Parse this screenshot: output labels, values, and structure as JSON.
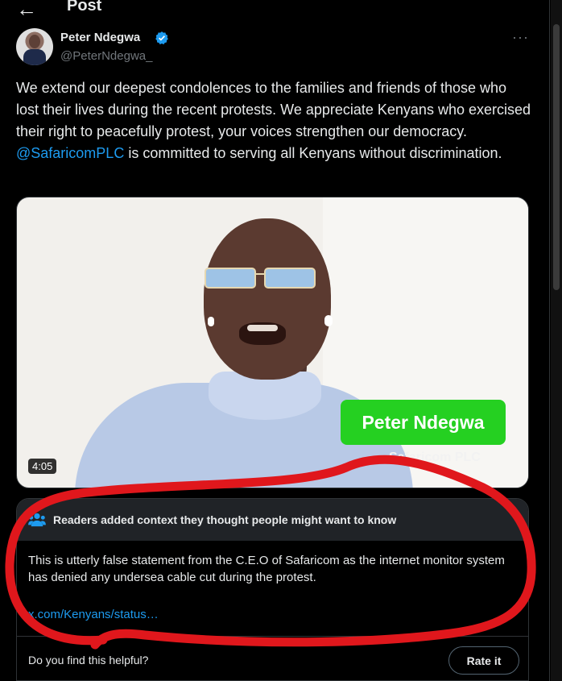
{
  "header": {
    "back_icon": "arrow-left-icon",
    "title": "Post"
  },
  "author": {
    "name": "Peter Ndegwa",
    "handle": "@PeterNdegwa_",
    "verified_icon": "verified-badge-icon",
    "verified_color": "#1d9bf0"
  },
  "post": {
    "text_before": "We extend our deepest condolences to the families and friends of those who lost their lives during the recent protests. We appreciate Kenyans who exercised their right to peacefully protest, your voices strengthen our democracy. ",
    "mention": "@SafaricomPLC",
    "text_after": " is committed to serving all Kenyans without discrimination."
  },
  "media": {
    "duration": "4:05",
    "overlay_name": "Peter Ndegwa",
    "overlay_org": "Safaricom PLC",
    "badge_color": "#25d021"
  },
  "community_note": {
    "icon": "people-icon",
    "title": "Readers added context they thought people might want to know",
    "body": "This is utterly false statement from the C.E.O of Safaricom as the internet monitor system has denied any undersea cable cut during the protest.",
    "link": "x.com/Kenyans/status…",
    "helpful_question": "Do you find this helpful?",
    "rate_label": "Rate it"
  },
  "colors": {
    "accent": "#1d9bf0",
    "annotation": "#e0171c"
  }
}
